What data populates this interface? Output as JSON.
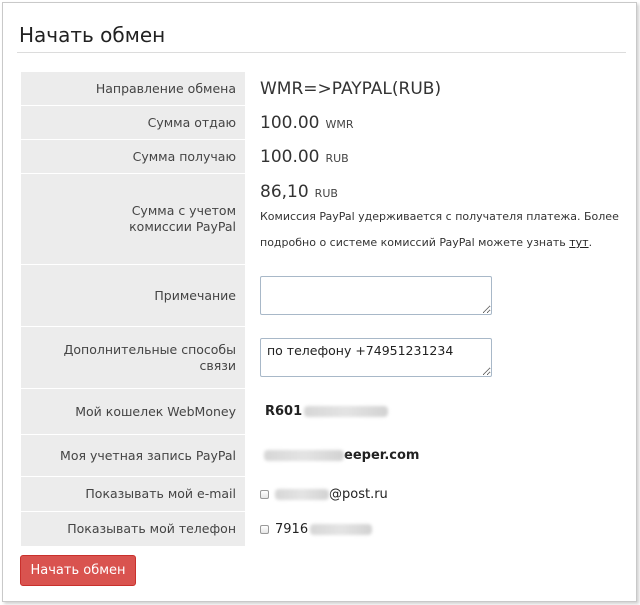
{
  "header": {
    "title": "Начать обмен"
  },
  "rows": {
    "direction": {
      "label": "Направление обмена",
      "value": "WMR=>PAYPAL(RUB)"
    },
    "give": {
      "label": "Сумма отдаю",
      "amount": "100.00",
      "unit": "WMR"
    },
    "receive": {
      "label": "Сумма получаю",
      "amount": "100.00",
      "unit": "RUB"
    },
    "with_fee": {
      "label": "Сумма с учетом комиссии PayPal",
      "amount": "86,10",
      "unit": "RUB",
      "note_line1": "Комиссия PayPal удерживается с получателя платежа. Более",
      "note_line2": "подробно о системе комиссий PayPal можете узнать",
      "link_text": "тут",
      "note_end": "."
    },
    "comment": {
      "label": "Примечание",
      "value": ""
    },
    "contacts": {
      "label": "Дополнительные способы связи",
      "value": "по телефону +74951231234"
    },
    "wallet": {
      "label": "Мой кошелек WebMoney",
      "value": "R601"
    },
    "paypal_account": {
      "label": "Моя учетная запись PayPal",
      "value": "eeper.com"
    },
    "show_email": {
      "label": "Показывать мой e-mail",
      "value": "@post.ru",
      "checked": false
    },
    "show_phone": {
      "label": "Показывать мой телефон",
      "value": "7916",
      "checked": false
    }
  },
  "submit": {
    "label": "Начать обмен"
  }
}
